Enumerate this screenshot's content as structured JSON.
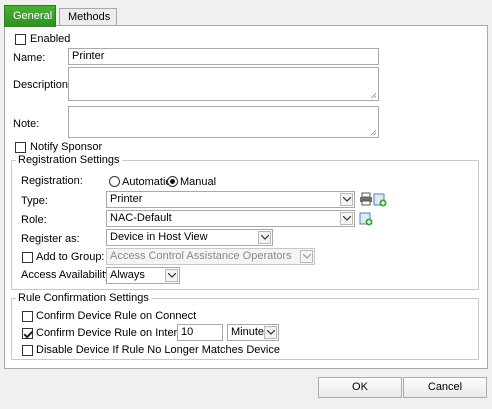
{
  "tabs": [
    {
      "label": "General",
      "active": true
    },
    {
      "label": "Methods",
      "active": false
    }
  ],
  "enabled": {
    "label": "Enabled",
    "checked": false
  },
  "name": {
    "label": "Name:",
    "value": "Printer"
  },
  "description": {
    "label": "Description:",
    "value": ""
  },
  "note": {
    "label": "Note:",
    "value": ""
  },
  "notify_sponsor": {
    "label": "Notify Sponsor",
    "checked": false
  },
  "registration_settings": {
    "legend": "Registration Settings",
    "registration": {
      "label": "Registration:",
      "options": [
        "Automatic",
        "Manual"
      ],
      "selected": "Manual"
    },
    "type": {
      "label": "Type:",
      "value": "Printer"
    },
    "role": {
      "label": "Role:",
      "value": "NAC-Default"
    },
    "register_as": {
      "label": "Register as:",
      "value": "Device in Host View"
    },
    "add_to_group": {
      "label": "Add to Group:",
      "checked": false,
      "value": "Access Control Assistance Operators"
    },
    "access_availability": {
      "label": "Access Availability:",
      "value": "Always"
    }
  },
  "rule_confirmation": {
    "legend": "Rule Confirmation Settings",
    "confirm_on_connect": {
      "label": "Confirm Device Rule on Connect",
      "checked": false
    },
    "confirm_on_interval": {
      "label": "Confirm Device Rule on Interval:",
      "checked": true,
      "interval": "10",
      "unit": "Minutes"
    },
    "disable_device": {
      "label": "Disable Device If Rule No Longer Matches Device",
      "checked": false
    }
  },
  "buttons": {
    "ok": "OK",
    "cancel": "Cancel"
  },
  "colors": {
    "active_tab": "#3a9d2b",
    "panel_border": "#a9a9a9"
  }
}
